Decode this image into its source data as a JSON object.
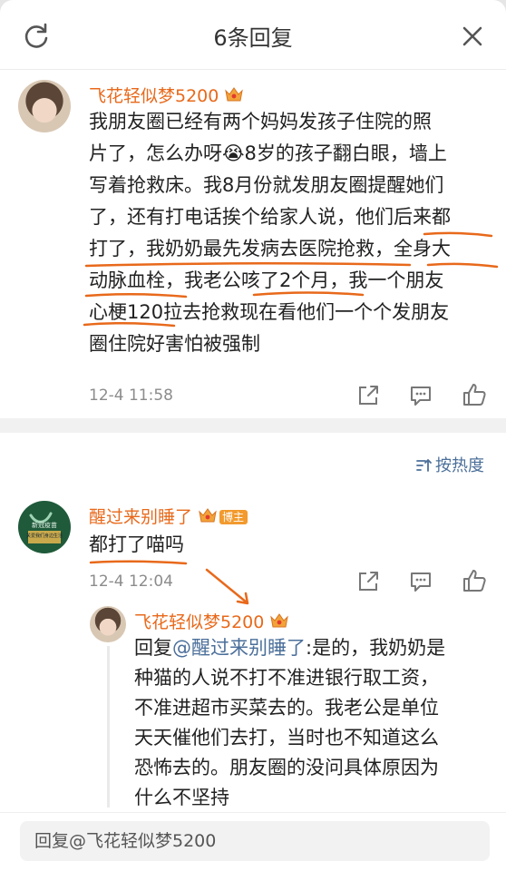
{
  "header": {
    "title": "6条回复"
  },
  "main_comment": {
    "username": "飞花轻似梦5200",
    "lines": [
      "我朋友圈已经有两个妈妈发孩子住院的照",
      "片了，怎么办呀😭8岁的孩子翻白眼，墙上",
      "写着抢救床。我8月份就发朋友圈提醒她们",
      "了，还有打电话挨个给家人说，他们后来都",
      "打了，我奶奶最先发病去医院抢救，全身大",
      "动脉血栓，我老公咳了2个月，我一个朋友",
      "心梗120拉去抢救现在看他们一个个发朋友",
      "圈住院好害怕被强制"
    ],
    "time": "12-4 11:58"
  },
  "sort": {
    "label": "按热度"
  },
  "reply1": {
    "username": "醒过来别睡了",
    "badge": "博主",
    "avatar_text_1": "新冠疫苗",
    "avatar_text_2": "关爱我们身边生活",
    "text": "都打了喵吗",
    "time": "12-4 12:04"
  },
  "reply2": {
    "username": "飞花轻似梦5200",
    "prefix": "回复",
    "mention": "@醒过来别睡了",
    "line1_rest": ":是的，我奶奶是",
    "lines": [
      "种猫的人说不打不准进银行取工资，",
      "不准进超市买菜去的。我老公是单位",
      "天天催他们去打，当时也不知道这么",
      "恐怖去的。朋友圈的没问具体原因为",
      "什么不坚持"
    ]
  },
  "reply_input": {
    "placeholder": "回复@飞花轻似梦5200"
  },
  "colors": {
    "username": "#e8691b",
    "mention": "#4b6f9a",
    "annotation": "#e8691b"
  }
}
